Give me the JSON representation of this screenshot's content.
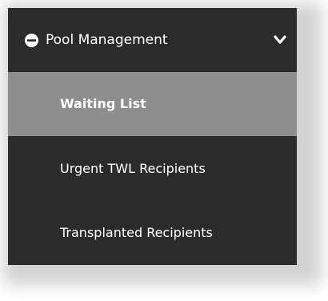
{
  "menu": {
    "header": {
      "label": "Pool Management",
      "icon": "half-circle-icon",
      "toggle_icon": "chevron-down-icon",
      "expanded": true
    },
    "items": [
      {
        "label": "Waiting List",
        "active": true
      },
      {
        "label": "Urgent TWL Recipients",
        "active": false
      },
      {
        "label": "Transplanted Recipients",
        "active": false
      }
    ]
  },
  "colors": {
    "menu_background": "#2b2b2b",
    "active_background": "#8e8e8e",
    "text": "#ffffff"
  }
}
